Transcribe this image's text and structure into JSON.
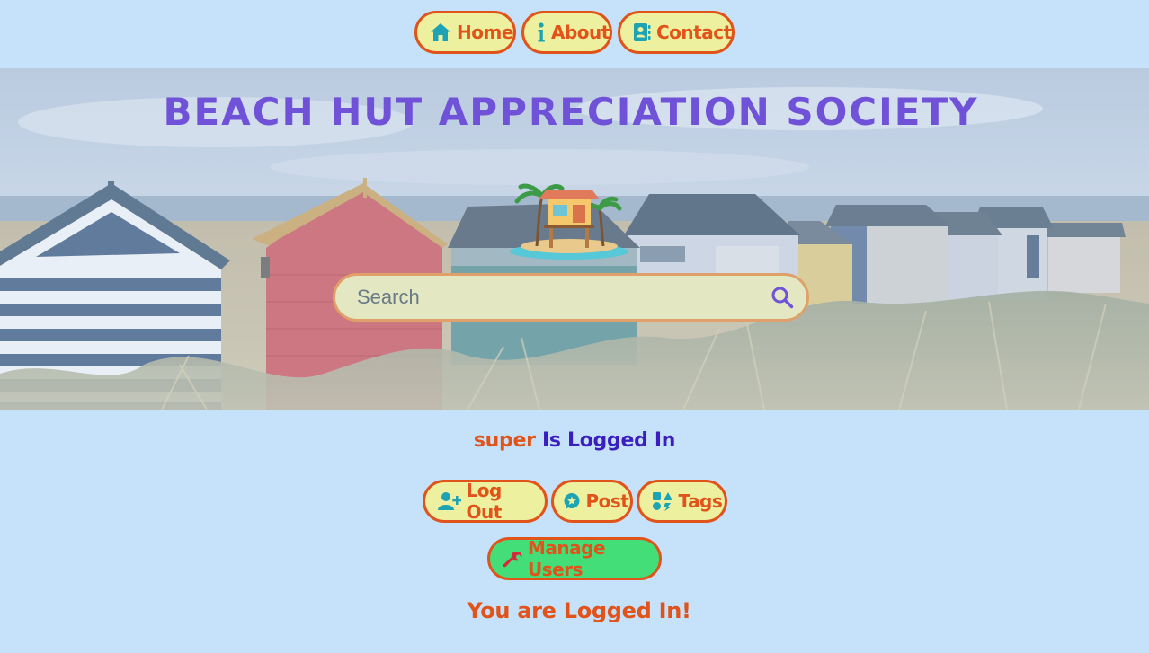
{
  "nav": {
    "items": [
      {
        "label": "Home",
        "icon": "home-icon"
      },
      {
        "label": "About",
        "icon": "info-icon"
      },
      {
        "label": "Contact",
        "icon": "address-book-icon"
      }
    ]
  },
  "hero": {
    "title": "BEACH HUT APPRECIATION SOCIETY",
    "search": {
      "placeholder": "Search",
      "value": ""
    }
  },
  "session": {
    "username": "super",
    "status_text": "Is Logged In"
  },
  "actions": {
    "logout_label": "Log Out",
    "post_label": "Post",
    "tags_label": "Tags",
    "manage_users_label": "Manage Users"
  },
  "footer": {
    "message": "You are Logged In!"
  },
  "colors": {
    "page_bg": "#c6e2fb",
    "pill_bg": "#edf09e",
    "pill_text": "#e0531a",
    "icon": "#1ea3b5",
    "title": "#7052d8",
    "status_user": "#e0531a",
    "status_text": "#3a1ec0",
    "manage_bg": "#44de78"
  }
}
